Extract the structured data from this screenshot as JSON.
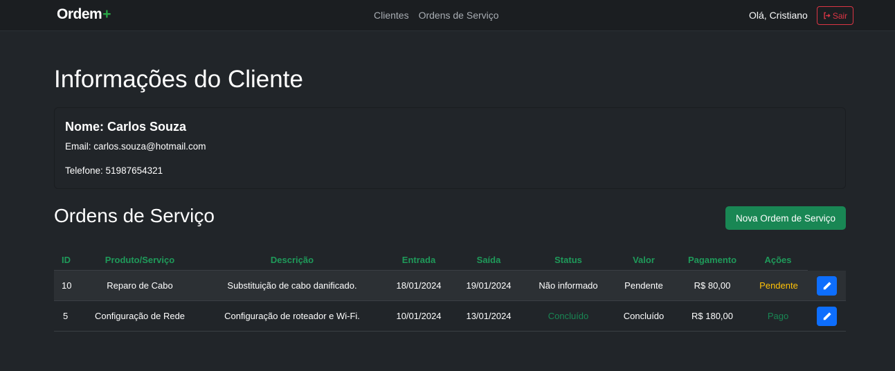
{
  "navbar": {
    "brand": "Ordem",
    "brand_plus": "+",
    "links": [
      "Clientes",
      "Ordens de Serviço"
    ],
    "greeting": "Olá, Cristiano",
    "logout_label": "Sair"
  },
  "page": {
    "title": "Informações do Cliente"
  },
  "client": {
    "name": "Nome: Carlos Souza",
    "email": "Email: carlos.souza@hotmail.com",
    "phone": "Telefone: 51987654321"
  },
  "orders": {
    "title": "Ordens de Serviço",
    "new_button": "Nova Ordem de Serviço",
    "columns": [
      "ID",
      "Produto/Serviço",
      "Descrição",
      "Entrada",
      "Saída",
      "Status",
      "Valor",
      "Pagamento",
      "Ações"
    ],
    "rows": [
      {
        "id": "10",
        "product": "Reparo de Cabo",
        "description": "Substituição de cabo danificado.",
        "entry": "18/01/2024",
        "exit": "19/01/2024",
        "status": "Não informado",
        "value": "Pendente",
        "payment": "R$ 80,00",
        "actions": "Pendente"
      },
      {
        "id": "5",
        "product": "Configuração de Rede",
        "description": "Configuração de roteador e Wi-Fi.",
        "entry": "10/01/2024",
        "exit": "13/01/2024",
        "status": "Concluído",
        "value": "Concluído",
        "payment": "R$ 180,00",
        "actions": "Pago"
      }
    ]
  },
  "colors": {
    "background": "#212529",
    "accent_green": "#198754",
    "danger": "#dc3545",
    "primary": "#0d6efd",
    "warning": "#ffc107"
  },
  "icons": {
    "logout": "sign-out-icon",
    "edit": "pencil-icon"
  }
}
